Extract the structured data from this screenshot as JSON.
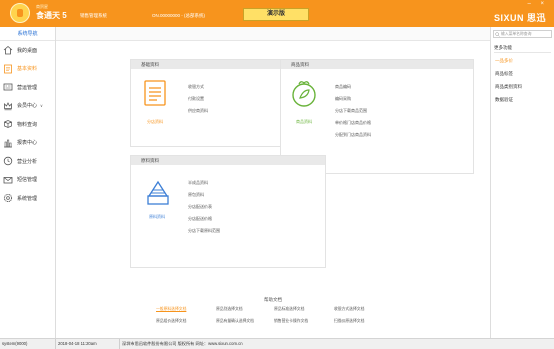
{
  "app": {
    "subtitle": "商贸星",
    "name": "食通天 5",
    "module": "销售管理系统",
    "company": "ON.00000000 - (总部系统)",
    "title_badge": "演示版",
    "brand": "SIXUN 思迅",
    "window_controls": "– ×"
  },
  "sidebar": {
    "header": "系统导航",
    "items": [
      {
        "label": "我的桌面",
        "icon": "home-icon"
      },
      {
        "label": "基本资料",
        "icon": "document-icon",
        "active": true
      },
      {
        "label": "营运管理",
        "icon": "register-icon"
      },
      {
        "label": "会员中心",
        "icon": "crown-icon",
        "has_chevron": true
      },
      {
        "label": "物料查询",
        "icon": "box-icon"
      },
      {
        "label": "报表中心",
        "icon": "bar-chart-icon"
      },
      {
        "label": "营业分析",
        "icon": "clock-icon"
      },
      {
        "label": "短信管理",
        "icon": "mail-icon"
      },
      {
        "label": "系统管理",
        "icon": "gear-icon"
      }
    ]
  },
  "panels": {
    "basic": {
      "title": "基础资料",
      "icon_label": "分店资料",
      "links": [
        "收银方式",
        "付款设置",
        "供应商资料"
      ]
    },
    "product": {
      "title": "商品资料",
      "icon_label": "商品资料",
      "links": [
        "商品编码",
        "编码采购",
        "分店下载商品范围",
        "单价格门店商品价格",
        "分配到门店商品资料"
      ]
    },
    "material": {
      "title": "原料资料",
      "icon_label": "原料资料",
      "links": [
        "半成品资料",
        "原包资料",
        "分店配送价表",
        "分店配送价格",
        "分店下载原料范围"
      ]
    }
  },
  "help": {
    "title": "帮助文档",
    "links": [
      "一般原料选择文档",
      "原品别选择文档",
      "原品标准选择文档",
      "收银方式选择文档",
      "原品组价选择文档",
      "原品有量确认选择文档",
      "销售营业卡操作文档",
      "扫描仪原选择文档"
    ]
  },
  "right_panel": {
    "search_placeholder": "输入菜单名称查询",
    "header": "更多功能",
    "items": [
      {
        "label": "一品多价",
        "active": true
      },
      {
        "label": "商品标签"
      },
      {
        "label": "商品类别资料"
      },
      {
        "label": "数据验证"
      }
    ]
  },
  "status": {
    "user": "system(9000)",
    "datetime": "2018-04-18 11:20am",
    "company_info": "深圳市思迅软件股份有限公司 版权所有 网址：www.sixun.com.cn"
  },
  "colors": {
    "accent": "#f7941d",
    "green": "#69b33a",
    "blue": "#3d7fd6"
  }
}
